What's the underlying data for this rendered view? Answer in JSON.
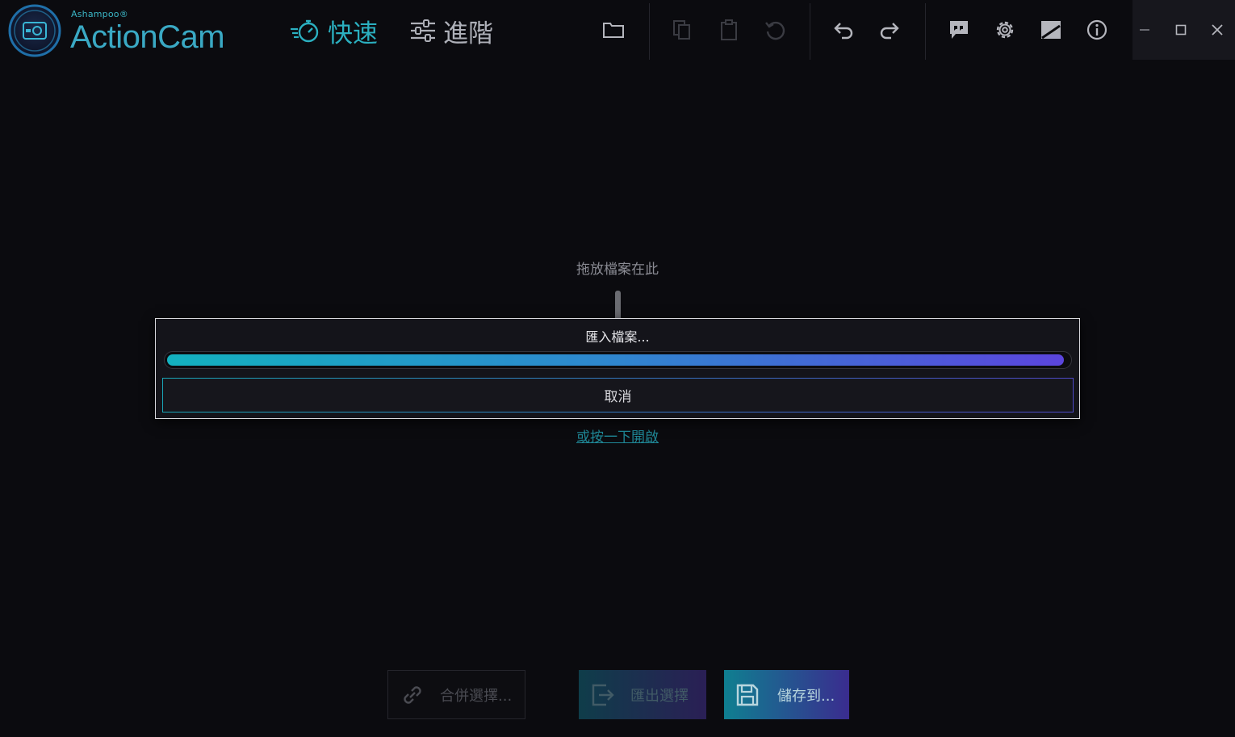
{
  "app": {
    "brand_small": "Ashampoo®",
    "brand_name": "ActionCam"
  },
  "modes": {
    "fast_label": "快速",
    "advanced_label": "進階"
  },
  "toolbar": {
    "icons": [
      "folder-icon",
      "copy-icon",
      "clipboard-icon",
      "reset-icon",
      "undo-icon",
      "redo-icon",
      "feedback-icon",
      "gear-icon",
      "exposure-icon",
      "info-icon"
    ]
  },
  "window_controls": {
    "icons": [
      "minimize-icon",
      "maximize-icon",
      "close-icon"
    ]
  },
  "dropzone": {
    "hint": "拖放檔案在此",
    "open_link": "或按一下開啟"
  },
  "dialog": {
    "title": "匯入檔案...",
    "progress": 0.995,
    "cancel_label": "取消"
  },
  "actions": {
    "merge_label": "合併選擇...",
    "export_label": "匯出選擇",
    "save_label": "儲存到..."
  },
  "colors": {
    "accent_teal": "#2bb0c0",
    "accent_purple": "#5b45dd",
    "background": "#0b0b0f"
  }
}
